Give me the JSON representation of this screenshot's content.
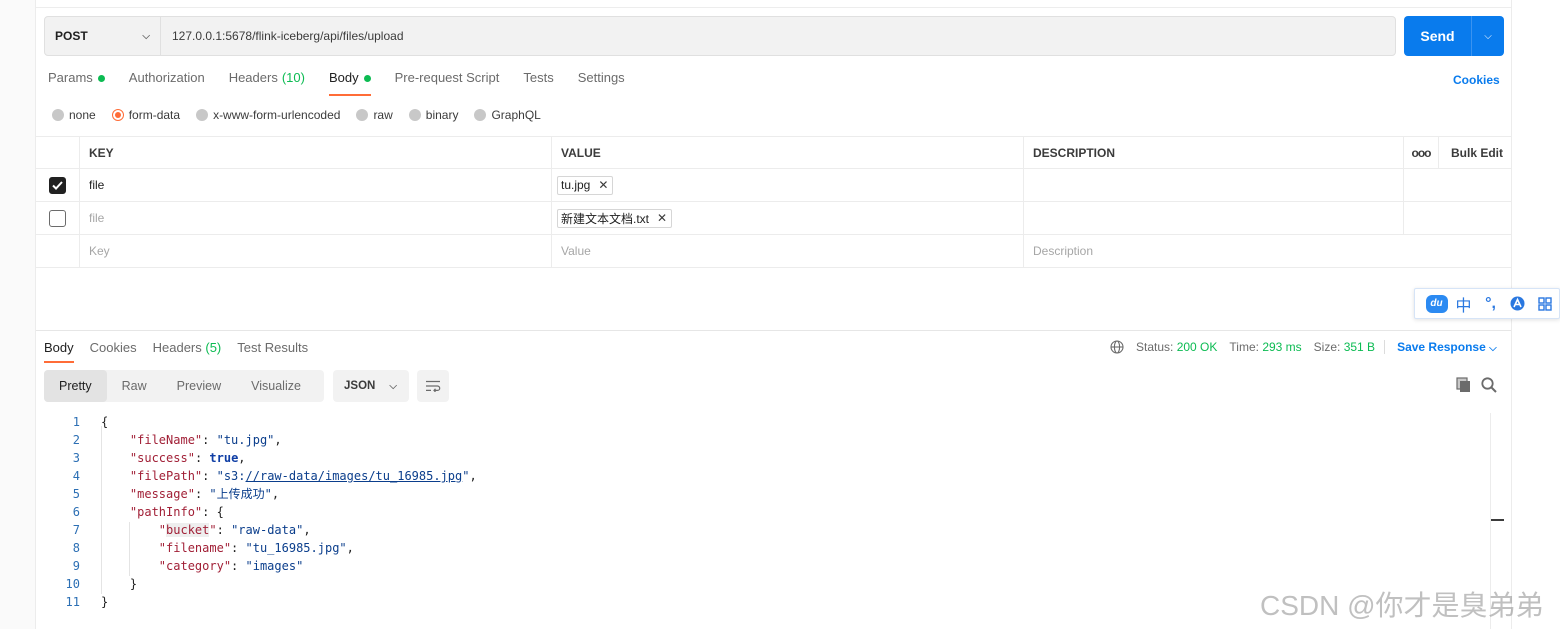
{
  "request": {
    "method": "POST",
    "url": "127.0.0.1:5678/flink-iceberg/api/files/upload",
    "send_label": "Send"
  },
  "request_tabs": [
    {
      "label": "Params",
      "dot": true
    },
    {
      "label": "Authorization"
    },
    {
      "label": "Headers",
      "count": "(10)"
    },
    {
      "label": "Body",
      "dot": true,
      "active": true
    },
    {
      "label": "Pre-request Script"
    },
    {
      "label": "Tests"
    },
    {
      "label": "Settings"
    }
  ],
  "cookies_link": "Cookies",
  "body_types": [
    {
      "label": "none"
    },
    {
      "label": "form-data",
      "selected": true
    },
    {
      "label": "x-www-form-urlencoded"
    },
    {
      "label": "raw"
    },
    {
      "label": "binary"
    },
    {
      "label": "GraphQL"
    }
  ],
  "form_table": {
    "headers": {
      "key": "KEY",
      "value": "VALUE",
      "description": "DESCRIPTION",
      "more": "ooo",
      "bulk_edit": "Bulk Edit"
    },
    "rows": [
      {
        "checked": true,
        "key": "file",
        "file": "tu.jpg",
        "description": ""
      },
      {
        "checked": false,
        "key": "file",
        "file": "新建文本文档.txt",
        "description": ""
      }
    ],
    "placeholders": {
      "key": "Key",
      "value": "Value",
      "description": "Description"
    }
  },
  "ime_toolbar": {
    "logo": "du",
    "lang": "中",
    "punct": "°,"
  },
  "response_tabs": [
    {
      "label": "Body",
      "active": true
    },
    {
      "label": "Cookies"
    },
    {
      "label": "Headers",
      "count": "(5)"
    },
    {
      "label": "Test Results"
    }
  ],
  "response_meta": {
    "status_label": "Status:",
    "status_value": "200 OK",
    "time_label": "Time:",
    "time_value": "293 ms",
    "size_label": "Size:",
    "size_value": "351 B",
    "save_label": "Save Response"
  },
  "view_modes": [
    "Pretty",
    "Raw",
    "Preview",
    "Visualize"
  ],
  "format": "JSON",
  "response_lines": [
    {
      "n": "1",
      "html": "{"
    },
    {
      "n": "2",
      "html": "    <span class='k'>\"fileName\"</span>: <span class='s'>\"tu.jpg\"</span>,"
    },
    {
      "n": "3",
      "html": "    <span class='k'>\"success\"</span>: <span class='b'>true</span>,"
    },
    {
      "n": "4",
      "html": "    <span class='k'>\"filePath\"</span>: <span class='s'>\"s3:<span class='u'>//raw-data/images/tu_16985.jpg</span>\"</span>,"
    },
    {
      "n": "5",
      "html": "    <span class='k'>\"message\"</span>: <span class='s'>\"上传成功\"</span>,"
    },
    {
      "n": "6",
      "html": "    <span class='k'>\"pathInfo\"</span>: {"
    },
    {
      "n": "7",
      "html": "        <span class='k'>\"<span class='hl'>bucket</span>\"</span>: <span class='s'>\"raw-data\"</span>,"
    },
    {
      "n": "8",
      "html": "        <span class='k'>\"filename\"</span>: <span class='s'>\"tu_16985.jpg\"</span>,"
    },
    {
      "n": "9",
      "html": "        <span class='k'>\"category\"</span>: <span class='s'>\"images\"</span>"
    },
    {
      "n": "10",
      "html": "    }"
    },
    {
      "n": "11",
      "html": "}"
    }
  ],
  "watermark": "CSDN @你才是臭弟弟"
}
